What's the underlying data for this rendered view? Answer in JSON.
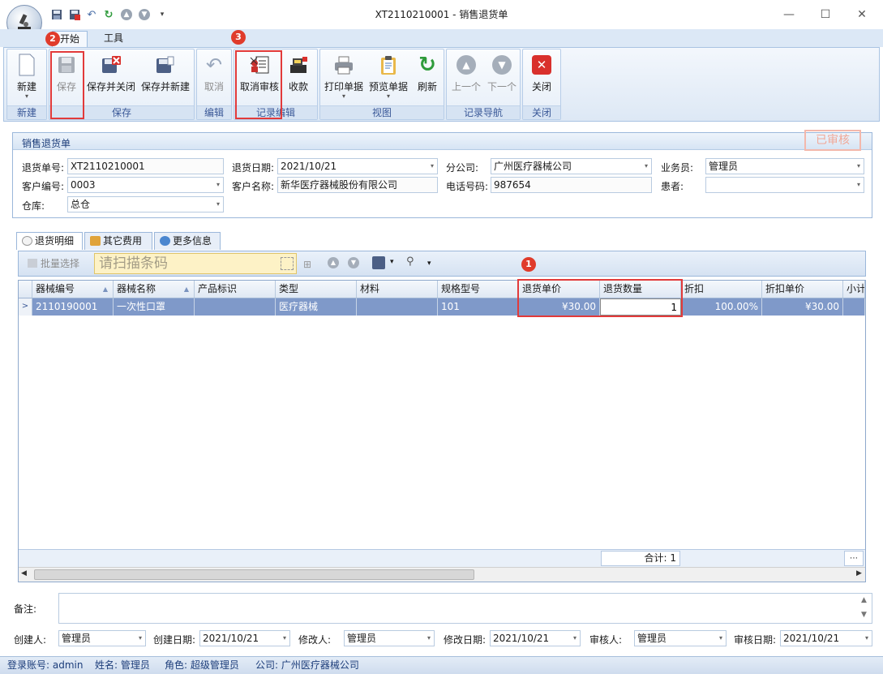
{
  "window": {
    "title": "XT2110210001 - 销售退货单"
  },
  "ribbon": {
    "tabs": [
      {
        "label": "开始"
      },
      {
        "label": "工具"
      }
    ],
    "groups": {
      "new": {
        "label": "新建",
        "new_btn": "新建"
      },
      "save": {
        "label": "保存",
        "save_btn": "保存",
        "save_close_btn": "保存并关闭",
        "save_new_btn": "保存并新建"
      },
      "edit": {
        "label": "编辑",
        "cancel_btn": "取消"
      },
      "record": {
        "label": "记录编辑",
        "unaudit_btn": "取消审核",
        "collect_btn": "收款"
      },
      "view": {
        "label": "视图",
        "print_btn": "打印单据",
        "preview_btn": "预览单据",
        "refresh_btn": "刷新"
      },
      "nav": {
        "label": "记录导航",
        "prev_btn": "上一个",
        "next_btn": "下一个"
      },
      "close": {
        "label": "关闭",
        "close_btn": "关闭"
      }
    }
  },
  "badges": {
    "b1": "1",
    "b2": "2",
    "b3": "3"
  },
  "form": {
    "title": "销售退货单",
    "stamp": "已审核",
    "return_no_label": "退货单号:",
    "return_no": "XT2110210001",
    "return_date_label": "退货日期:",
    "return_date": "2021/10/21",
    "branch_label": "分公司:",
    "branch": "广州医疗器械公司",
    "salesman_label": "业务员:",
    "salesman": "管理员",
    "customer_no_label": "客户编号:",
    "customer_no": "0003",
    "customer_name_label": "客户名称:",
    "customer_name": "新华医疗器械股份有限公司",
    "phone_label": "电话号码:",
    "phone": "987654",
    "patient_label": "患者:",
    "patient": "",
    "warehouse_label": "仓库:",
    "warehouse": "总仓"
  },
  "detail_tabs": [
    {
      "label": "退货明细"
    },
    {
      "label": "其它费用"
    },
    {
      "label": "更多信息"
    }
  ],
  "toolbar": {
    "batch_select": "批量选择",
    "scan_placeholder": "请扫描条码"
  },
  "grid": {
    "columns": [
      "器械编号",
      "器械名称",
      "产品标识",
      "类型",
      "材料",
      "规格型号",
      "退货单价",
      "退货数量",
      "折扣",
      "折扣单价",
      "小计"
    ],
    "rows": [
      {
        "code": "2110190001",
        "name": "一次性口罩",
        "udi": "",
        "type": "医疗器械",
        "material": "",
        "spec": "101",
        "price": "¥30.00",
        "qty": "1",
        "discount": "100.00%",
        "disc_price": "¥30.00",
        "subtotal": ""
      }
    ],
    "total": "合计: 1"
  },
  "memo": {
    "label": "备注:",
    "value": ""
  },
  "footer": {
    "creator_label": "创建人:",
    "creator": "管理员",
    "create_date_label": "创建日期:",
    "create_date": "2021/10/21",
    "modifier_label": "修改人:",
    "modifier": "管理员",
    "modify_date_label": "修改日期:",
    "modify_date": "2021/10/21",
    "auditor_label": "审核人:",
    "auditor": "管理员",
    "audit_date_label": "审核日期:",
    "audit_date": "2021/10/21"
  },
  "status": {
    "account": "登录账号: admin",
    "name": "姓名: 管理员",
    "role": "角色: 超级管理员",
    "company": "公司: 广州医疗器械公司"
  },
  "colors": {
    "accent": "#e23a3a",
    "selection": "#7f99c9",
    "ribbon_bg": "#dde8f5",
    "stamp": "#f0a898"
  }
}
